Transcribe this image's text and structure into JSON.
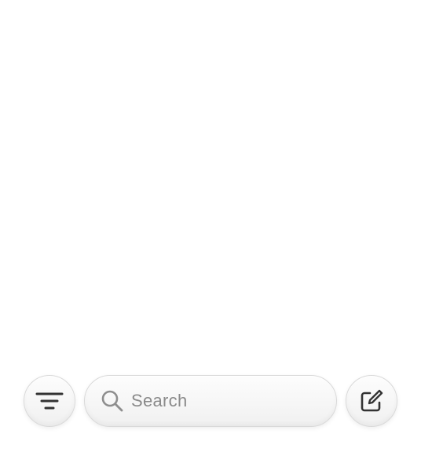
{
  "toolbar": {
    "filter_icon": "filter-lines-icon",
    "search": {
      "icon": "magnifying-glass-icon",
      "placeholder": "Search",
      "value": ""
    },
    "compose_icon": "compose-square-pencil-icon"
  },
  "colors": {
    "background": "#ffffff",
    "button_surface": "#f6f6f6",
    "button_border": "#d9d9d9",
    "icon": "#333333",
    "placeholder": "#8a8a8a",
    "search_icon": "#8e8e8e"
  }
}
